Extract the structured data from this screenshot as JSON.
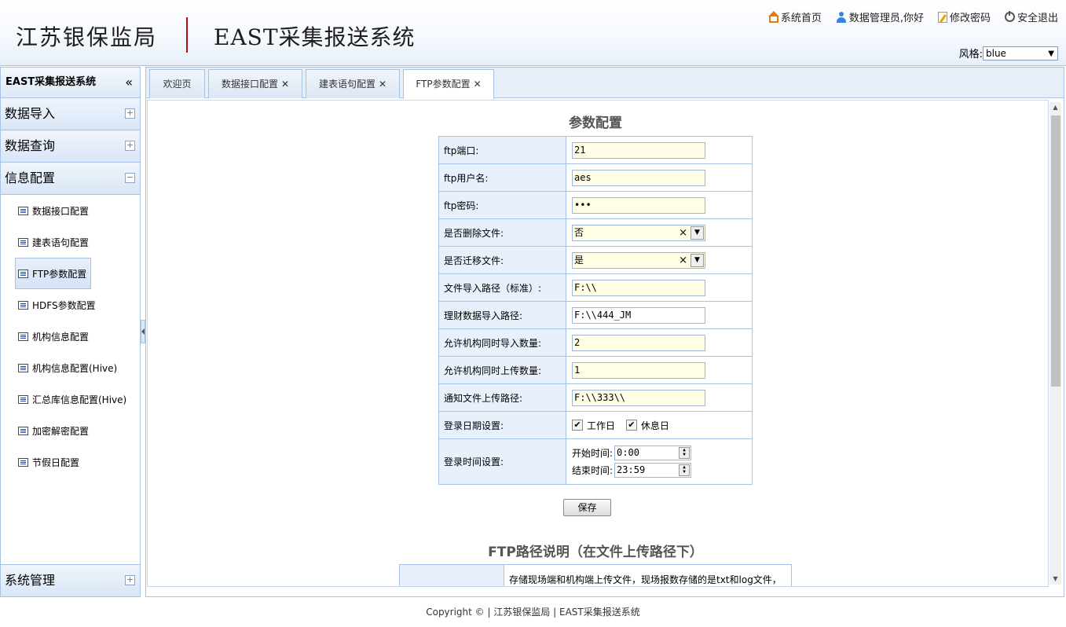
{
  "header": {
    "org": "江苏银保监局",
    "system": "EAST采集报送系统",
    "links": {
      "home": "系统首页",
      "user": "数据管理员,你好",
      "password": "修改密码",
      "logout": "安全退出"
    },
    "style_label": "风格:",
    "style_value": "blue"
  },
  "sidebar": {
    "title": "EAST采集报送系统",
    "collapse": "«",
    "groups": [
      "数据导入",
      "数据查询",
      "信息配置",
      "系统管理"
    ],
    "items": [
      "数据接口配置",
      "建表语句配置",
      "FTP参数配置",
      "HDFS参数配置",
      "机构信息配置",
      "机构信息配置(Hive)",
      "汇总库信息配置(Hive)",
      "加密解密配置",
      "节假日配置"
    ]
  },
  "tabs": [
    "欢迎页",
    "数据接口配置",
    "建表语句配置",
    "FTP参数配置"
  ],
  "form": {
    "title": "参数配置",
    "rows": {
      "ftp_port": {
        "label": "ftp端口:",
        "value": "21"
      },
      "ftp_user": {
        "label": "ftp用户名:",
        "value": "aes"
      },
      "ftp_password": {
        "label": "ftp密码:",
        "value": "•••"
      },
      "delete_file": {
        "label": "是否删除文件:",
        "value": "否"
      },
      "move_file": {
        "label": "是否迁移文件:",
        "value": "是"
      },
      "import_path": {
        "label": "文件导入路径（标准）:",
        "value": "F:\\\\"
      },
      "finance_path": {
        "label": "理财数据导入路径:",
        "value": "F:\\\\444_JM"
      },
      "import_count": {
        "label": "允许机构同时导入数量:",
        "value": "2"
      },
      "upload_count": {
        "label": "允许机构同时上传数量:",
        "value": "1"
      },
      "notice_path": {
        "label": "通知文件上传路径:",
        "value": "F:\\\\333\\\\"
      },
      "login_date": {
        "label": "登录日期设置:",
        "workday": "工作日",
        "holiday": "休息日"
      },
      "login_time": {
        "label": "登录时间设置:",
        "start_label": "开始时间:",
        "start": "0:00",
        "end_label": "结束时间:",
        "end": "23:59"
      }
    },
    "save": "保存"
  },
  "ftp_desc": {
    "title": "FTP路径说明（在文件上传路径下）",
    "text": "存储现场端和机构端上传文件，现场报数存储的是txt和log文件，"
  },
  "footer": "Copyright © | 江苏银保监局 | EAST采集报送系统"
}
